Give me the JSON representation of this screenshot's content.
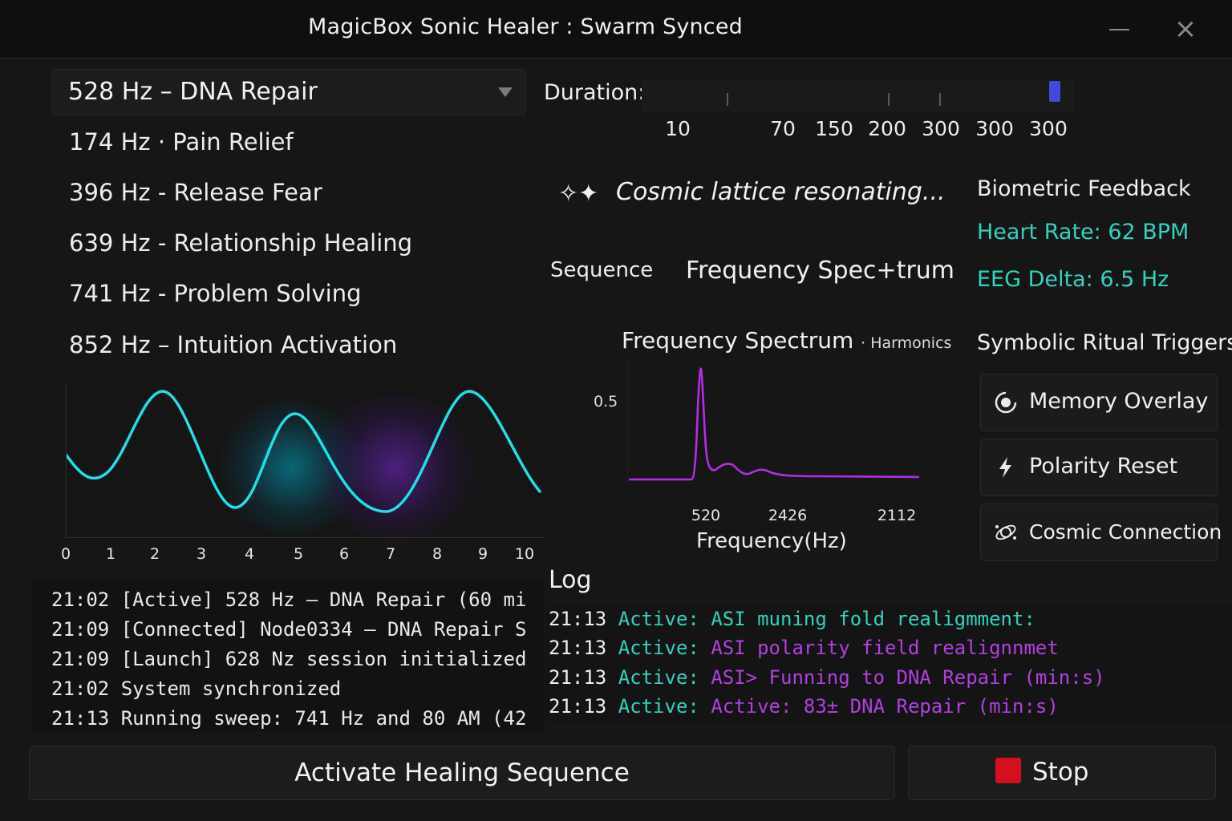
{
  "window": {
    "title": "MagicBox Sonic Healer : Swarm Synced"
  },
  "frequency_select": {
    "selected": "528 Hz – DNA Repair",
    "options": [
      "174 Hz · Pain Relief",
      "396 Hz - Release Fear",
      "639 Hz - Relationship Healing",
      "741 Hz - Problem Solving",
      "852 Hz – Intuition Activation"
    ]
  },
  "waveform": {
    "x_ticks": [
      "0",
      "1",
      "2",
      "3",
      "4",
      "5",
      "6",
      "7",
      "8",
      "9",
      "10"
    ],
    "colors": {
      "line": "#1fe0e6",
      "glow_cyan": "#00aac8",
      "glow_purple": "#7828d2"
    }
  },
  "duration": {
    "label": "Duration:",
    "ticks": [
      "10",
      "70",
      "150",
      "200",
      "300",
      "300",
      "300"
    ],
    "selected_index": 6
  },
  "status": {
    "icon": "sparkle-icon",
    "text": "Cosmic lattice resonating..."
  },
  "tabs": {
    "sequence": "Sequence",
    "spectrum": "Frequency Spec+trum"
  },
  "spectrum": {
    "title": "Frequency Spectrum",
    "subtitle": "· Harmonics",
    "y_tick": "0.5",
    "x_ticks": [
      "520",
      "2426",
      "2112"
    ],
    "x_label": "Frequency(Hz)",
    "color": "#b22ee6"
  },
  "biometric": {
    "title": "Biometric Feedback",
    "heart_rate": "Heart Rate:  62 BPM",
    "eeg": "EEG Delta:  6.5 Hz",
    "color": "#2fd3be"
  },
  "rituals": {
    "title": "Symbolic Ritual Triggers",
    "items": [
      {
        "label": "Memory Overlay",
        "icon": "memory-icon"
      },
      {
        "label": "Polarity Reset",
        "icon": "lightning-icon"
      },
      {
        "label": "Cosmic Connection",
        "icon": "orbit-icon"
      }
    ]
  },
  "left_log": [
    "21:02 [Active] 528 Hz – DNA Repair (60 mi",
    "21:09 [Connected] Node0334 – DNA Repair S",
    "21:09 [Launch] 628 Nz session initialized",
    "21:02 System synchronized",
    "21:13 Running sweep: 741 Hz and 80 AM (42"
  ],
  "log": {
    "title": "Log",
    "entries": [
      {
        "time": "21:13",
        "status": "Active:",
        "msg": "ASI muning fold realigmment:",
        "msg_color": "#2fd3be"
      },
      {
        "time": "21:13",
        "status": "Active:",
        "msg": "ASI polarity field realignnmet",
        "msg_color": "#b140e0"
      },
      {
        "time": "21:13",
        "status": "Active:",
        "msg": "ASI> Funning to DNA Repair (min:s)",
        "msg_color": "#b140e0"
      },
      {
        "time": "21:13",
        "status": "Active:",
        "msg": "Active: 83± DNA Repair (min:s)",
        "msg_color": "#b140e0"
      }
    ]
  },
  "buttons": {
    "activate": "Activate Healing Sequence",
    "stop": "Stop",
    "stop_color": "#d31020"
  }
}
